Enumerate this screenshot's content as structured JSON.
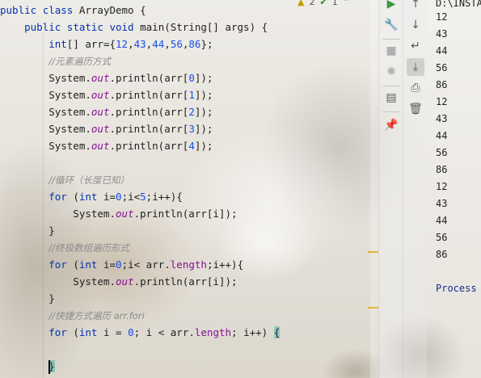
{
  "inspection": {
    "warnings": "2",
    "ok": "1"
  },
  "editor": {
    "lines": [
      {
        "tokens": [
          [
            "kw",
            "public "
          ],
          [
            "kw",
            "class "
          ],
          [
            "plain",
            "ArrayDemo {"
          ]
        ]
      },
      {
        "tokens": [
          [
            "plain",
            "    "
          ],
          [
            "kw",
            "public "
          ],
          [
            "kw",
            "static "
          ],
          [
            "kw",
            "void "
          ],
          [
            "plain",
            "main(String[] args) {"
          ]
        ]
      },
      {
        "tokens": [
          [
            "plain",
            "        "
          ],
          [
            "kw",
            "int"
          ],
          [
            "plain",
            "[] arr={"
          ],
          [
            "num",
            "12"
          ],
          [
            "plain",
            ","
          ],
          [
            "num",
            "43"
          ],
          [
            "plain",
            ","
          ],
          [
            "num",
            "44"
          ],
          [
            "plain",
            ","
          ],
          [
            "num",
            "56"
          ],
          [
            "plain",
            ","
          ],
          [
            "num",
            "86"
          ],
          [
            "plain",
            "};"
          ]
        ]
      },
      {
        "tokens": [
          [
            "plain",
            "        "
          ],
          [
            "comment",
            "//元素遍历方式"
          ]
        ]
      },
      {
        "tokens": [
          [
            "plain",
            "        System."
          ],
          [
            "field",
            "out"
          ],
          [
            "plain",
            ".println(arr["
          ],
          [
            "num",
            "0"
          ],
          [
            "plain",
            "]);"
          ]
        ]
      },
      {
        "tokens": [
          [
            "plain",
            "        System."
          ],
          [
            "field",
            "out"
          ],
          [
            "plain",
            ".println(arr["
          ],
          [
            "num",
            "1"
          ],
          [
            "plain",
            "]);"
          ]
        ]
      },
      {
        "tokens": [
          [
            "plain",
            "        System."
          ],
          [
            "field",
            "out"
          ],
          [
            "plain",
            ".println(arr["
          ],
          [
            "num",
            "2"
          ],
          [
            "plain",
            "]);"
          ]
        ]
      },
      {
        "tokens": [
          [
            "plain",
            "        System."
          ],
          [
            "field",
            "out"
          ],
          [
            "plain",
            ".println(arr["
          ],
          [
            "num",
            "3"
          ],
          [
            "plain",
            "]);"
          ]
        ]
      },
      {
        "tokens": [
          [
            "plain",
            "        System."
          ],
          [
            "field",
            "out"
          ],
          [
            "plain",
            ".println(arr["
          ],
          [
            "num",
            "4"
          ],
          [
            "plain",
            "]);"
          ]
        ]
      },
      {
        "tokens": []
      },
      {
        "tokens": [
          [
            "plain",
            "        "
          ],
          [
            "comment",
            "//循环（长度已知）"
          ]
        ]
      },
      {
        "tokens": [
          [
            "plain",
            "        "
          ],
          [
            "kw",
            "for "
          ],
          [
            "plain",
            "("
          ],
          [
            "kw",
            "int "
          ],
          [
            "plain",
            "i="
          ],
          [
            "num",
            "0"
          ],
          [
            "plain",
            ";i<"
          ],
          [
            "num",
            "5"
          ],
          [
            "plain",
            ";i++){"
          ]
        ]
      },
      {
        "tokens": [
          [
            "plain",
            "            System."
          ],
          [
            "field",
            "out"
          ],
          [
            "plain",
            ".println(arr[i]);"
          ]
        ]
      },
      {
        "tokens": [
          [
            "plain",
            "        }"
          ]
        ]
      },
      {
        "tokens": [
          [
            "plain",
            "        "
          ],
          [
            "comment",
            "//终极数组遍历形式"
          ]
        ]
      },
      {
        "tokens": [
          [
            "plain",
            "        "
          ],
          [
            "kw",
            "for "
          ],
          [
            "plain",
            "("
          ],
          [
            "kw",
            "int "
          ],
          [
            "plain",
            "i="
          ],
          [
            "num",
            "0"
          ],
          [
            "plain",
            ";i< arr."
          ],
          [
            "field2",
            "length"
          ],
          [
            "plain",
            ";i++){"
          ]
        ]
      },
      {
        "tokens": [
          [
            "plain",
            "            System."
          ],
          [
            "field",
            "out"
          ],
          [
            "plain",
            ".println(arr[i]);"
          ]
        ]
      },
      {
        "tokens": [
          [
            "plain",
            "        }"
          ]
        ]
      },
      {
        "tokens": [
          [
            "plain",
            "        "
          ],
          [
            "comment",
            "//快捷方式遍历 arr.fori"
          ]
        ]
      },
      {
        "tokens": [
          [
            "plain",
            "        "
          ],
          [
            "kw",
            "for "
          ],
          [
            "plain",
            "("
          ],
          [
            "kw",
            "int "
          ],
          [
            "plain",
            "i = "
          ],
          [
            "num",
            "0"
          ],
          [
            "plain",
            "; i < arr."
          ],
          [
            "field2",
            "length"
          ],
          [
            "plain",
            "; i++) "
          ],
          [
            "hl",
            "{"
          ]
        ]
      },
      {
        "tokens": []
      },
      {
        "tokens": [
          [
            "plain",
            "        "
          ],
          [
            "hl",
            "}"
          ]
        ]
      }
    ]
  },
  "output": {
    "header": "D:\\INSTA",
    "values": [
      "12",
      "43",
      "44",
      "56",
      "86",
      "12",
      "43",
      "44",
      "56",
      "86",
      "12",
      "43",
      "44",
      "56",
      "86"
    ],
    "process": "Process"
  },
  "toolbar": {
    "icons": [
      "run-icon",
      "wrench-icon",
      "stop-icon",
      "debug-icon",
      "layout-icon",
      "pin-icon"
    ],
    "icons2": [
      "arrow-up-icon",
      "arrow-down-icon",
      "soft-wrap-icon",
      "scroll-to-end-icon",
      "print-icon",
      "trash-icon"
    ]
  }
}
